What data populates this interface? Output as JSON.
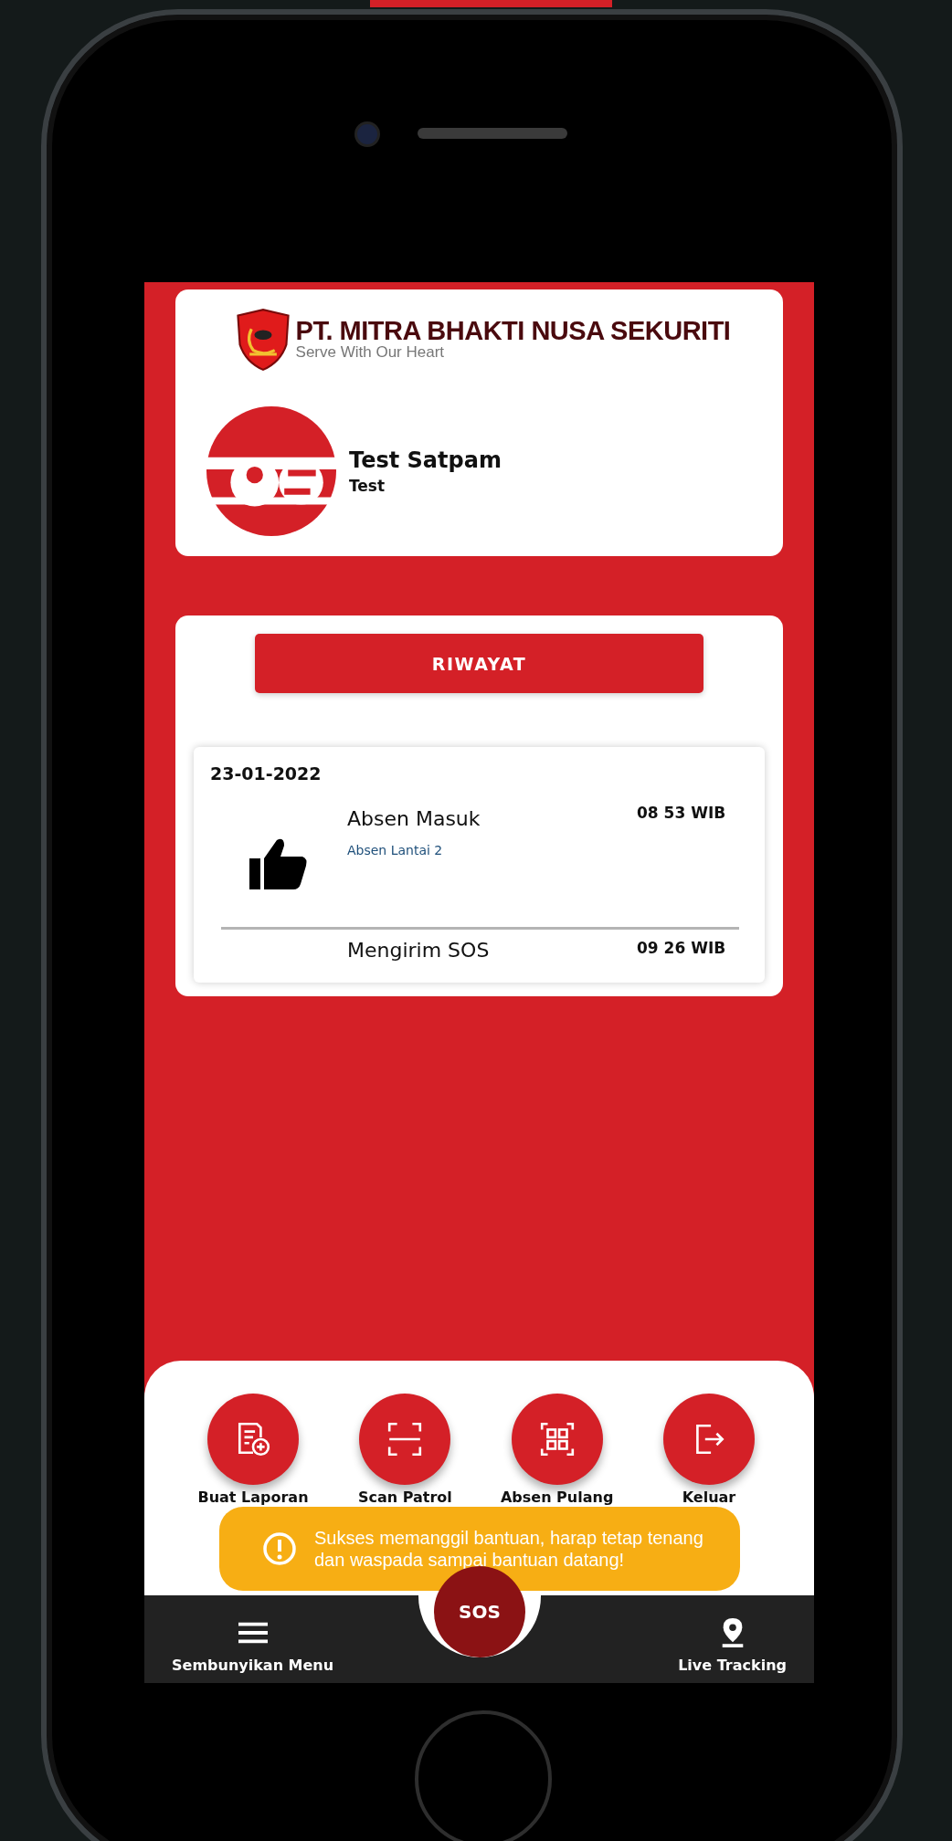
{
  "company": {
    "name": "PT. MITRA BHAKTI NUSA SEKURITI",
    "tagline": "Serve With Our Heart"
  },
  "profile": {
    "name": "Test Satpam",
    "role": "Test"
  },
  "history": {
    "button": "RIWAYAT",
    "date": "23-01-2022",
    "entries": [
      {
        "title": "Absen Masuk",
        "detail": "Absen Lantai 2",
        "time": "08 53 WIB",
        "kind": "thumbs-up"
      },
      {
        "title": "Mengirim SOS",
        "time": "09 26 WIB",
        "kind": "none"
      }
    ]
  },
  "actions": [
    {
      "label": "Buat Laporan",
      "kind": "report"
    },
    {
      "label": "Scan Patrol",
      "kind": "scan"
    },
    {
      "label": "Absen Pulang",
      "kind": "qr"
    },
    {
      "label": "Keluar",
      "kind": "logout"
    }
  ],
  "toast": {
    "message": "Sukses memanggil bantuan, harap tetap tenang dan waspada sampai bantuan datang!"
  },
  "nav": {
    "left": "Sembunyikan Menu",
    "sos": "SOS",
    "right": "Live Tracking"
  }
}
